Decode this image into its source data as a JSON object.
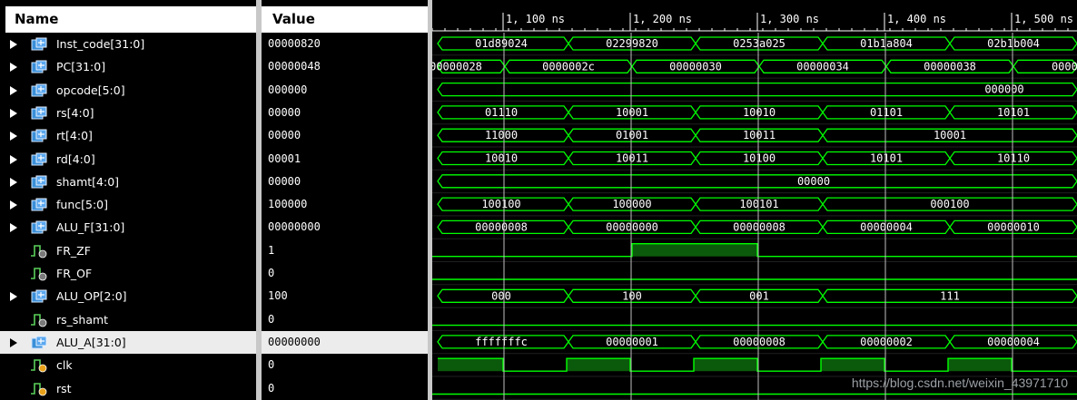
{
  "header": {
    "name_label": "Name",
    "value_label": "Value"
  },
  "timeline": {
    "tick_labels": [
      "1, 100 ns",
      "1, 200 ns",
      "1, 300 ns",
      "1, 400 ns",
      "1, 500 ns"
    ]
  },
  "signals": [
    {
      "name": "Inst_code[31:0]",
      "value": "00000820",
      "kind": "bus",
      "segments": [
        "01d89024",
        "02299820",
        "0253a025",
        "01b1a804",
        "02b1b004"
      ]
    },
    {
      "name": "PC[31:0]",
      "value": "00000048",
      "kind": "bus",
      "segments": [
        "00000028",
        "0000002c",
        "00000030",
        "00000034",
        "00000038",
        "00000"
      ]
    },
    {
      "name": "opcode[5:0]",
      "value": "000000",
      "kind": "bus",
      "segments": [
        "000000"
      ]
    },
    {
      "name": "rs[4:0]",
      "value": "00000",
      "kind": "bus",
      "segments": [
        "01110",
        "10001",
        "10010",
        "01101",
        "10101"
      ]
    },
    {
      "name": "rt[4:0]",
      "value": "00000",
      "kind": "bus",
      "segments": [
        "11000",
        "01001",
        "10011",
        "10001"
      ]
    },
    {
      "name": "rd[4:0]",
      "value": "00001",
      "kind": "bus",
      "segments": [
        "10010",
        "10011",
        "10100",
        "10101",
        "10110"
      ]
    },
    {
      "name": "shamt[4:0]",
      "value": "00000",
      "kind": "bus",
      "segments": [
        "00000"
      ]
    },
    {
      "name": "func[5:0]",
      "value": "100000",
      "kind": "bus",
      "segments": [
        "100100",
        "100000",
        "100101",
        "000100"
      ]
    },
    {
      "name": "ALU_F[31:0]",
      "value": "00000000",
      "kind": "bus",
      "segments": [
        "00000008",
        "00000000",
        "00000008",
        "00000004",
        "00000010"
      ]
    },
    {
      "name": "FR_ZF",
      "value": "1",
      "kind": "bit"
    },
    {
      "name": "FR_OF",
      "value": "0",
      "kind": "bit"
    },
    {
      "name": "ALU_OP[2:0]",
      "value": "100",
      "kind": "bus",
      "segments": [
        "000",
        "100",
        "001",
        "111"
      ]
    },
    {
      "name": "rs_shamt",
      "value": "0",
      "kind": "bit"
    },
    {
      "name": "ALU_A[31:0]",
      "value": "00000000",
      "kind": "bus",
      "segments": [
        "fffffffc",
        "00000001",
        "00000008",
        "00000002",
        "00000004"
      ],
      "selected": true
    },
    {
      "name": "clk",
      "value": "0",
      "kind": "bit"
    },
    {
      "name": "rst",
      "value": "0",
      "kind": "bit"
    }
  ],
  "colors": {
    "wave": "#00ff00",
    "high_fill": "#0b5a0b",
    "cursor": "#c0c0c0"
  },
  "watermark": "https://blog.csdn.net/weixin_43971710"
}
